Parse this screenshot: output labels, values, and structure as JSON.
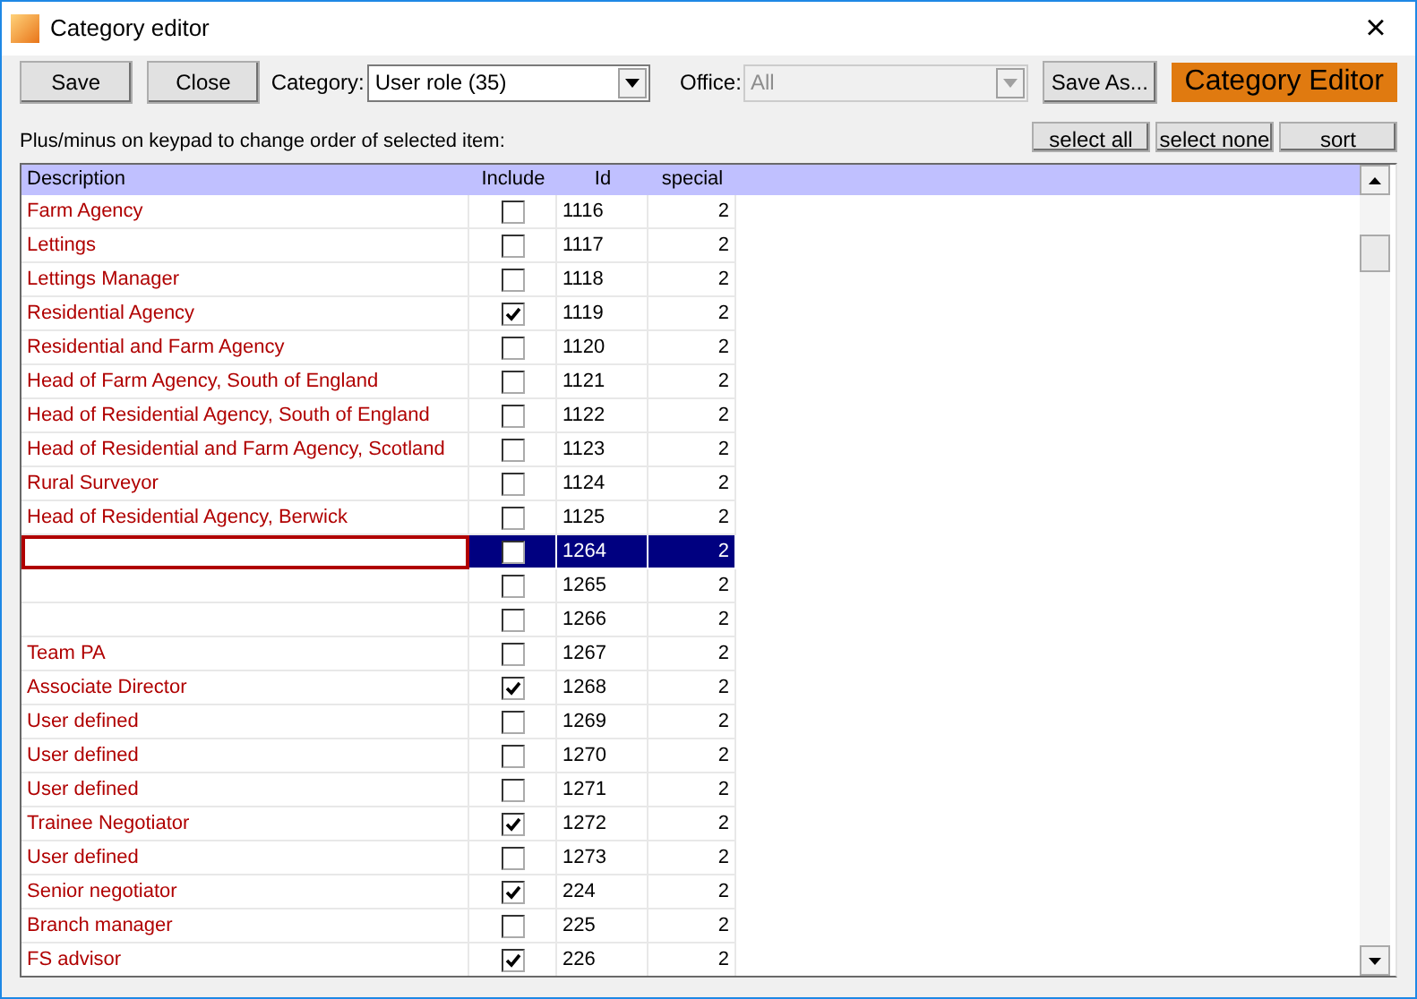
{
  "window": {
    "title": "Category editor",
    "close": "×"
  },
  "toolbar": {
    "save": "Save",
    "close": "Close",
    "category_label": "Category:",
    "category_value": "User role (35)",
    "office_label": "Office:",
    "office_value": "All",
    "office_disabled": true,
    "save_as": "Save As...",
    "banner": "Category Editor"
  },
  "hint": "Plus/minus on keypad to change order of selected item:",
  "actions": [
    "select all",
    "select none",
    "sort"
  ],
  "table": {
    "columns": [
      "Description",
      "Include",
      "Id",
      "special"
    ],
    "rows": [
      {
        "description": "Farm Agency",
        "include": false,
        "id": "1116",
        "special": "2",
        "selected": false
      },
      {
        "description": "Lettings",
        "include": false,
        "id": "1117",
        "special": "2",
        "selected": false
      },
      {
        "description": "Lettings Manager",
        "include": false,
        "id": "1118",
        "special": "2",
        "selected": false
      },
      {
        "description": "Residential Agency",
        "include": true,
        "id": "1119",
        "special": "2",
        "selected": false
      },
      {
        "description": "Residential and Farm Agency",
        "include": false,
        "id": "1120",
        "special": "2",
        "selected": false
      },
      {
        "description": "Head of Farm Agency, South of England",
        "include": false,
        "id": "1121",
        "special": "2",
        "selected": false
      },
      {
        "description": "Head of Residential Agency, South of England",
        "include": false,
        "id": "1122",
        "special": "2",
        "selected": false
      },
      {
        "description": "Head of Residential and Farm Agency, Scotland",
        "include": false,
        "id": "1123",
        "special": "2",
        "selected": false
      },
      {
        "description": "Rural Surveyor",
        "include": false,
        "id": "1124",
        "special": "2",
        "selected": false
      },
      {
        "description": "Head of Residential Agency, Berwick",
        "include": false,
        "id": "1125",
        "special": "2",
        "selected": false
      },
      {
        "include": false,
        "id": "1264",
        "special": "2",
        "selected": true
      },
      {
        "include": false,
        "id": "1265",
        "special": "2",
        "selected": false
      },
      {
        "include": false,
        "id": "1266",
        "special": "2",
        "selected": false
      },
      {
        "description": "Team PA",
        "include": false,
        "id": "1267",
        "special": "2",
        "selected": false
      },
      {
        "description": "Associate Director",
        "include": true,
        "id": "1268",
        "special": "2",
        "selected": false
      },
      {
        "description": "User defined",
        "include": false,
        "id": "1269",
        "special": "2",
        "selected": false
      },
      {
        "description": "User defined",
        "include": false,
        "id": "1270",
        "special": "2",
        "selected": false
      },
      {
        "description": "User defined",
        "include": false,
        "id": "1271",
        "special": "2",
        "selected": false
      },
      {
        "description": "Trainee Negotiator",
        "include": true,
        "id": "1272",
        "special": "2",
        "selected": false
      },
      {
        "description": "User defined",
        "include": false,
        "id": "1273",
        "special": "2",
        "selected": false
      },
      {
        "description": "Senior negotiator",
        "include": true,
        "id": "224",
        "special": "2",
        "selected": false
      },
      {
        "description": "Branch manager",
        "include": false,
        "id": "225",
        "special": "2",
        "selected": false
      },
      {
        "description": "FS advisor",
        "include": true,
        "id": "226",
        "special": "2",
        "selected": false
      }
    ]
  }
}
